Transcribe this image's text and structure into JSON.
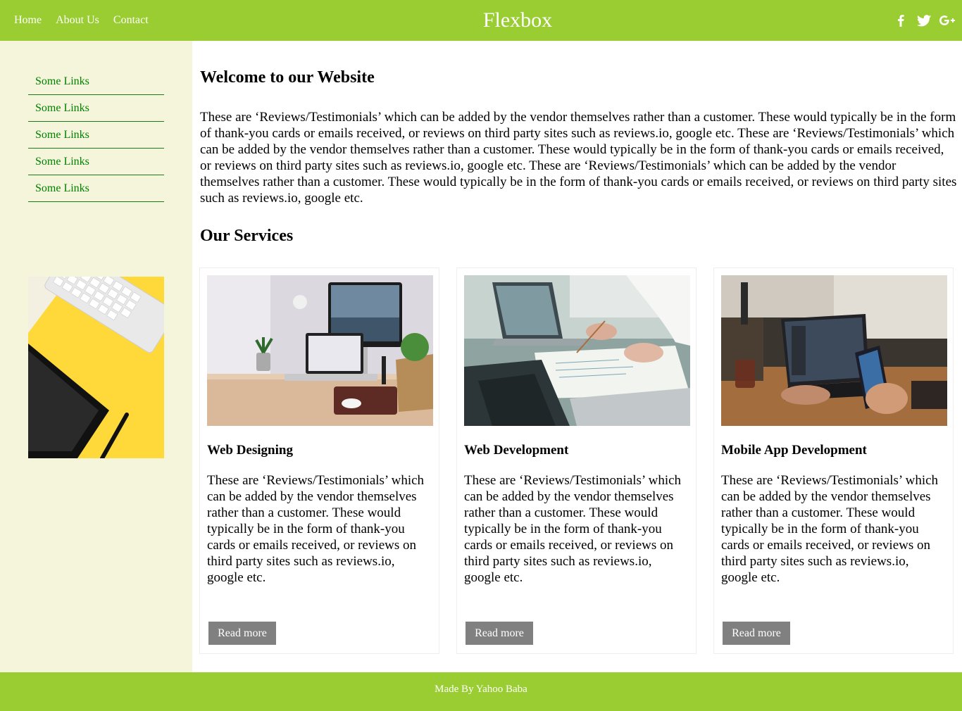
{
  "header": {
    "nav": [
      "Home",
      "About Us",
      "Contact"
    ],
    "brand": "Flexbox",
    "social": [
      "facebook-icon",
      "twitter-icon",
      "google-plus-icon"
    ],
    "background": "#9acd32"
  },
  "sidebar": {
    "links": [
      "Some Links",
      "Some Links",
      "Some Links",
      "Some Links",
      "Some Links"
    ],
    "link_color": "#008000",
    "background": "#f5f5dc"
  },
  "main": {
    "welcome_title": "Welcome to our Website",
    "intro": "These are ‘Reviews/Testimonials’ which can be added by the vendor themselves rather than a customer. These would typically be in the form of thank-you cards or emails received, or reviews on third party sites such as reviews.io, google etc. These are ‘Reviews/Testimonials’ which can be added by the vendor themselves rather than a customer. These would typically be in the form of thank-you cards or emails received, or reviews on third party sites such as reviews.io, google etc. These are ‘Reviews/Testimonials’ which can be added by the vendor themselves rather than a customer. These would typically be in the form of thank-you cards or emails received, or reviews on third party sites such as reviews.io, google etc.",
    "services_title": "Our Services",
    "cards": [
      {
        "title": "Web Designing",
        "text": "These are ‘Reviews/Testimonials’ which can be added by the vendor themselves rather than a customer. These would typically be in the form of thank-you cards or emails received, or reviews on third party sites such as reviews.io, google etc.",
        "button": "Read more"
      },
      {
        "title": "Web Development",
        "text": "These are ‘Reviews/Testimonials’ which can be added by the vendor themselves rather than a customer. These would typically be in the form of thank-you cards or emails received, or reviews on third party sites such as reviews.io, google etc.",
        "button": "Read more"
      },
      {
        "title": "Mobile App Development",
        "text": "These are ‘Reviews/Testimonials’ which can be added by the vendor themselves rather than a customer. These would typically be in the form of thank-you cards or emails received, or reviews on third party sites such as reviews.io, google etc.",
        "button": "Read more"
      }
    ]
  },
  "footer": {
    "text": "Made By Yahoo Baba"
  }
}
